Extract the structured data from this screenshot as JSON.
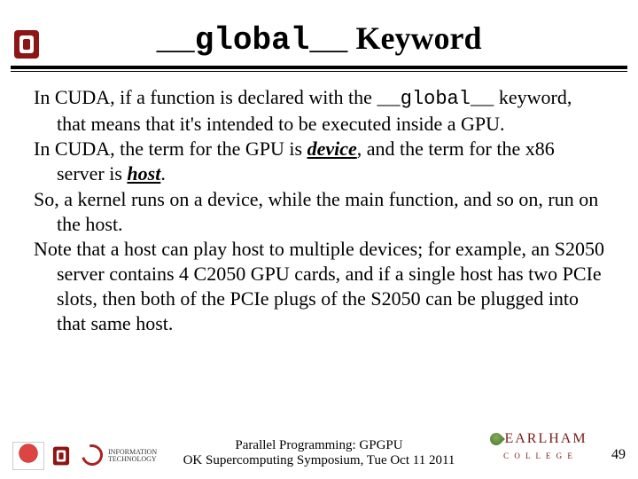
{
  "title": {
    "code": "__global__",
    "word": "Keyword"
  },
  "body": {
    "p1_a": "In CUDA, if a function is declared with the ",
    "p1_code": "__global__",
    "p1_b": " keyword, that means that it's intended to be executed inside a GPU.",
    "p2_a": "In CUDA, the term for the GPU is ",
    "p2_term1": "device",
    "p2_b": ", and the term for the x86 server is ",
    "p2_term2": "host",
    "p2_c": ".",
    "p3": "So, a kernel runs on a device, while the main function, and so on, run on the host.",
    "p4": "Note that a host can play host to multiple devices; for example, an S2050 server contains 4 C2050 GPU cards, and if a single host has two PCIe slots, then both of the PCIe plugs of the S2050 can be plugged into that same host."
  },
  "footer": {
    "line1": "Parallel Programming: GPGPU",
    "line2": "OK Supercomputing Symposium, Tue Oct 11 2011",
    "earlham_top": "EARLHAM",
    "earlham_bottom": "C O L L E G E",
    "page": "49"
  }
}
